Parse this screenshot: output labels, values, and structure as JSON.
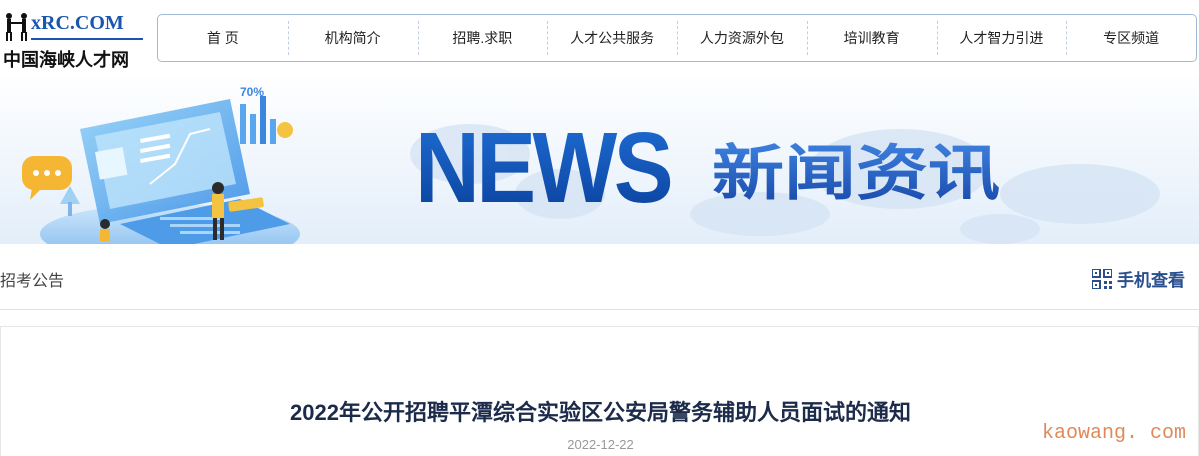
{
  "logo": {
    "text_prefix": "xR",
    "text_suffix": "C.COM",
    "subtitle": "中国海峡人才网"
  },
  "nav": {
    "items": [
      {
        "label": "首 页"
      },
      {
        "label": "机构简介"
      },
      {
        "label": "招聘.求职"
      },
      {
        "label": "人才公共服务"
      },
      {
        "label": "人力资源外包"
      },
      {
        "label": "培训教育"
      },
      {
        "label": "人才智力引进"
      },
      {
        "label": "专区频道"
      }
    ]
  },
  "banner": {
    "word_en": "NEWS",
    "word_cn": "新闻资讯",
    "chart_label": "70%"
  },
  "breadcrumb": {
    "text": "招考公告"
  },
  "mobile_view": {
    "label": "手机查看",
    "icon": "qr-code-icon"
  },
  "article": {
    "title": "2022年公开招聘平潭综合实验区公安局警务辅助人员面试的通知",
    "date": "2022-12-22"
  },
  "watermark": {
    "text": "kaowang. com"
  },
  "colors": {
    "brand_blue": "#1a55b0",
    "nav_border": "#9fbad6",
    "title": "#1c2b4a",
    "mobile_link": "#2a4f8f",
    "watermark": "#e08a5a"
  }
}
